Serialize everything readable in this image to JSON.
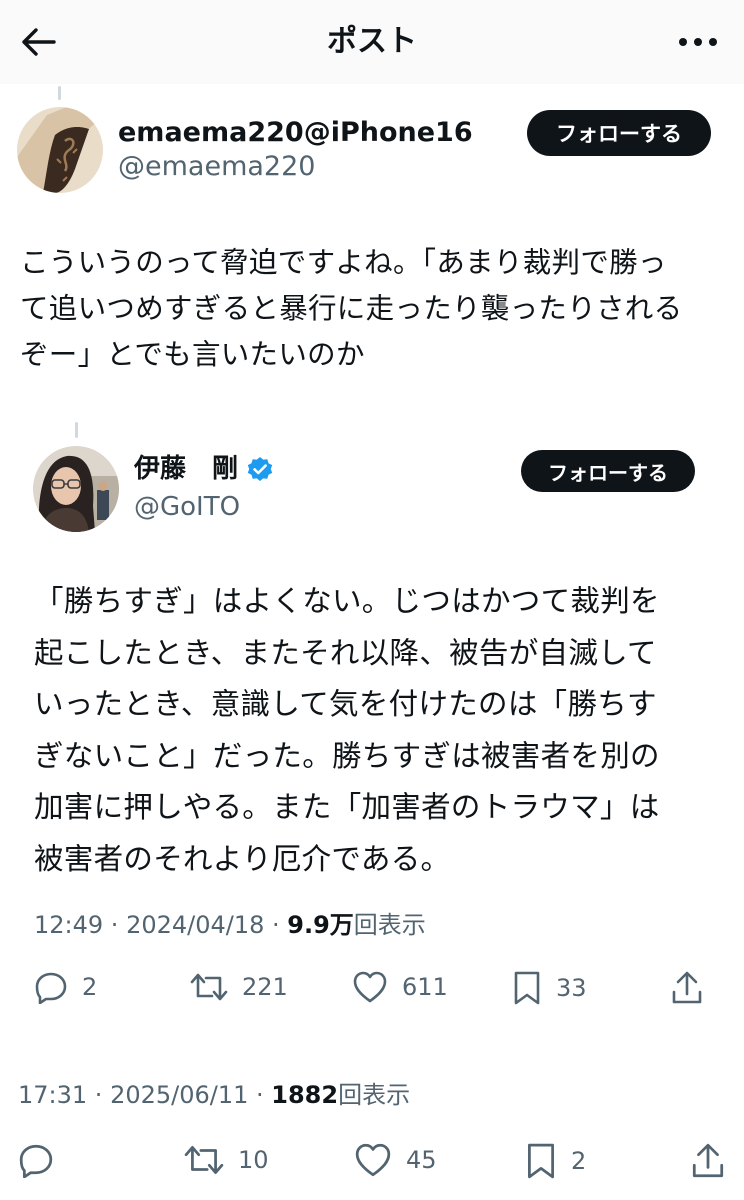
{
  "header": {
    "title": "ポスト"
  },
  "main_post": {
    "display_name": "emaema220@iPhone16",
    "handle": "@emaema220",
    "follow_label": "フォローする",
    "text": "こういうのって脅迫ですよね。「あまり裁判で勝っ\nて追いつめすぎると暴行に走ったり襲ったりされる\nぞー」とでも言いたいのか"
  },
  "quoted_post": {
    "display_name": "伊藤　剛",
    "verified": true,
    "handle": "@GoITO",
    "follow_label": "フォローする",
    "text": "「勝ちすぎ」はよくない。じつはかつて裁判を\n起こしたとき、またそれ以降、被告が自滅して\nいったとき、意識して気を付けたのは「勝ちす\nぎないこと」だった。勝ちすぎは被害者を別の\n加害に押しやる。また「加害者のトラウマ」は\n被害者のそれより厄介である。",
    "meta": {
      "time": "12:49",
      "sep1": " · ",
      "date": "2024/04/18",
      "sep2": " · ",
      "views": "9.9万",
      "views_label": "回表示"
    },
    "actions": {
      "reply": "2",
      "repost": "221",
      "like": "611",
      "bookmark": "33"
    }
  },
  "main_meta": {
    "time": "17:31",
    "sep1": " · ",
    "date": "2025/06/11",
    "sep2": " · ",
    "views": "1882",
    "views_label": "回表示"
  },
  "main_actions": {
    "reply": "",
    "repost": "10",
    "like": "45",
    "bookmark": "2"
  },
  "colors": {
    "text": "#0f1419",
    "secondary": "#536471",
    "verified": "#1d9bf0",
    "button_bg": "#0f1419"
  }
}
